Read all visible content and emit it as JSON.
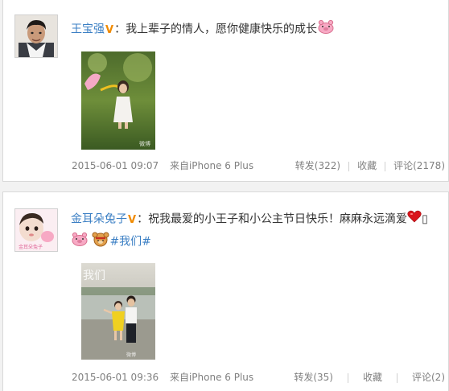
{
  "posts": [
    {
      "username": "王宝强",
      "verified_badge": "V",
      "colon": "：",
      "text": "我上辈子的情人，愿你健康快乐的成长",
      "timestamp": "2015-06-01 09:07",
      "source": "来自iPhone 6 Plus",
      "actions": {
        "repost": "转发(322)",
        "favorite": "收藏",
        "comment": "评论(2178)"
      },
      "photo_watermark": "微博"
    },
    {
      "username": "金耳朵兔子",
      "verified_badge": "V",
      "colon": "：",
      "text": "祝我最爱的小王子和小公主节日快乐！麻麻永远滴爱",
      "trailing_char": "▯",
      "hashtag": "#我们#",
      "avatar_text": "金耳朵兔子",
      "timestamp": "2015-06-01 09:36",
      "source": "来自iPhone 6 Plus",
      "actions": {
        "repost": "转发(35)",
        "favorite": "收藏",
        "comment": "评论(2)"
      },
      "photo_overlay_text": "我们"
    }
  ],
  "colors": {
    "link": "#3b7fc4",
    "meta": "#808080",
    "verified": "#f08a00"
  }
}
